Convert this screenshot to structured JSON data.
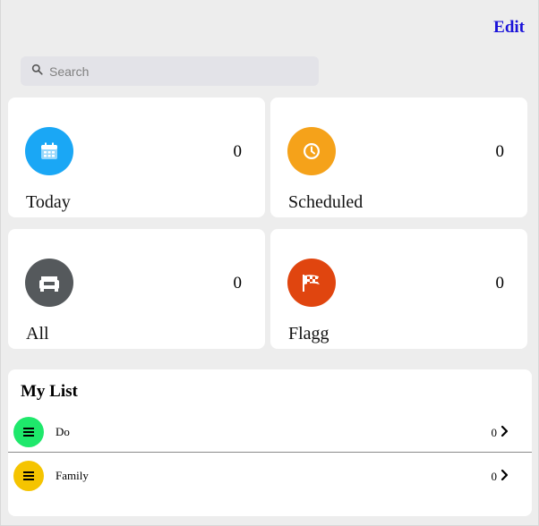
{
  "header": {
    "edit_label": "Edit"
  },
  "search": {
    "placeholder": "Search",
    "value": ""
  },
  "cards": [
    {
      "label": "Today",
      "count": "0",
      "color": "#1aa7f5",
      "icon": "calendar-icon"
    },
    {
      "label": "Scheduled",
      "count": "0",
      "color": "#f5a21a",
      "icon": "clock-icon"
    },
    {
      "label": "All",
      "count": "0",
      "color": "#55595c",
      "icon": "inbox-tray-icon"
    },
    {
      "label": "Flagg",
      "count": "0",
      "color": "#e0450f",
      "icon": "checkered-flag-icon"
    }
  ],
  "my_list": {
    "title": "My List",
    "items": [
      {
        "name": "Do",
        "count": "0",
        "color": "#1ee86b",
        "icon": "list-icon"
      },
      {
        "name": "Family",
        "count": "0",
        "color": "#f5c400",
        "icon": "list-icon"
      }
    ]
  },
  "colors": {
    "accent": "#1a12d9",
    "background": "#ededed",
    "search_bg": "#e3e3e8"
  }
}
